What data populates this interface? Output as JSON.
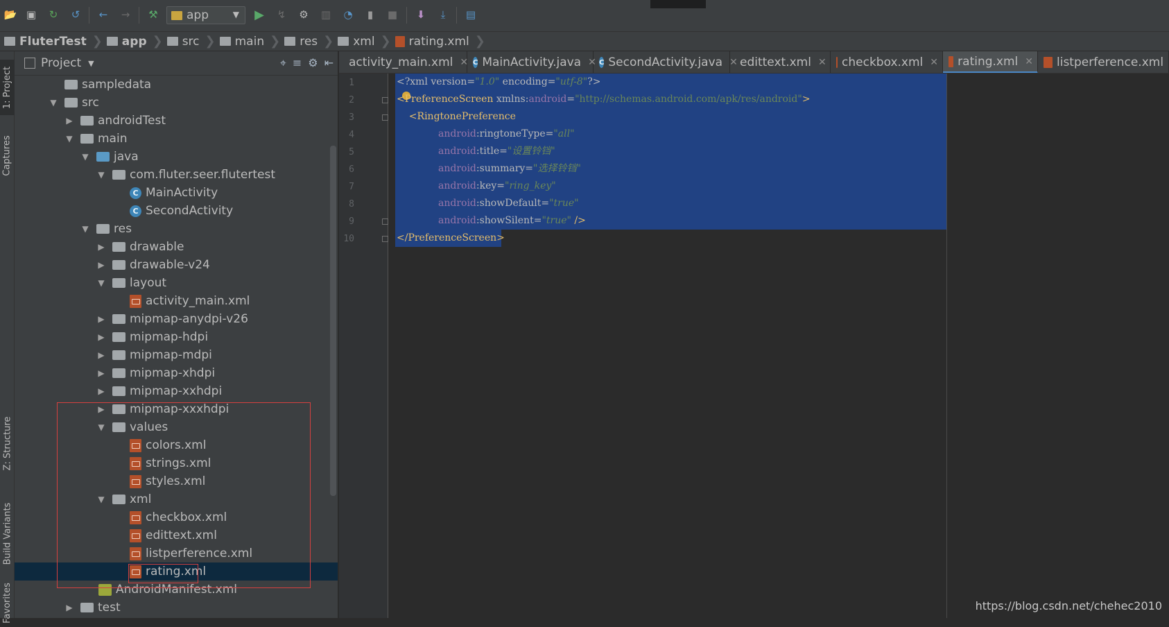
{
  "toolbar": {
    "run_config": "app",
    "icons": [
      "open-icon",
      "save-icon",
      "sync-icon",
      "refresh-icon",
      "back-icon",
      "forward-icon",
      "build-icon",
      "run-icon",
      "apply-changes-icon",
      "debug-icon",
      "attach-debugger-icon",
      "profiler-icon",
      "device-icon",
      "stop-icon",
      "sdk-manager-icon",
      "download-icon",
      "layout-inspector-icon"
    ]
  },
  "breadcrumb": [
    "FluterTest",
    "app",
    "src",
    "main",
    "res",
    "xml",
    "rating.xml"
  ],
  "left_strip": {
    "project": "1: Project",
    "captures": "Captures",
    "structure": "Z: Structure",
    "build_variants": "Build Variants",
    "favorites": "Favorites"
  },
  "project_panel": {
    "title": "Project",
    "tree": [
      {
        "label": "sampledata"
      },
      {
        "label": "src"
      },
      {
        "label": "androidTest"
      },
      {
        "label": "main"
      },
      {
        "label": "java"
      },
      {
        "label": "com.fluter.seer.flutertest"
      },
      {
        "label": "MainActivity"
      },
      {
        "label": "SecondActivity"
      },
      {
        "label": "res"
      },
      {
        "label": "drawable"
      },
      {
        "label": "drawable-v24"
      },
      {
        "label": "layout"
      },
      {
        "label": "activity_main.xml"
      },
      {
        "label": "mipmap-anydpi-v26"
      },
      {
        "label": "mipmap-hdpi"
      },
      {
        "label": "mipmap-mdpi"
      },
      {
        "label": "mipmap-xhdpi"
      },
      {
        "label": "mipmap-xxhdpi"
      },
      {
        "label": "mipmap-xxxhdpi"
      },
      {
        "label": "values"
      },
      {
        "label": "colors.xml"
      },
      {
        "label": "strings.xml"
      },
      {
        "label": "styles.xml"
      },
      {
        "label": "xml"
      },
      {
        "label": "checkbox.xml"
      },
      {
        "label": "edittext.xml"
      },
      {
        "label": "listperference.xml"
      },
      {
        "label": "rating.xml"
      },
      {
        "label": "AndroidManifest.xml"
      },
      {
        "label": "test"
      }
    ]
  },
  "tabs": [
    "activity_main.xml",
    "MainActivity.java",
    "SecondActivity.java",
    "edittext.xml",
    "checkbox.xml",
    "rating.xml",
    "listperference.xml"
  ],
  "tabs_active": "rating.xml",
  "editor": {
    "line_numbers": [
      "1",
      "2",
      "3",
      "4",
      "5",
      "6",
      "7",
      "8",
      "9",
      "10"
    ],
    "lines": [
      {
        "p1": "<?xml version=",
        "p2": "\"1.0\"",
        "p3": " encoding=",
        "p4": "\"utf-8\"",
        "p5": "?>"
      },
      {
        "p1": "<PreferenceScreen ",
        "p2": "xmlns:",
        "p3": "android",
        "p4": "=",
        "p5": "\"http://schemas.android.com/apk/res/android\"",
        "p6": ">"
      },
      {
        "p1": "    <RingtonePreference"
      },
      {
        "ns": "android",
        "att": ":ringtoneType=",
        "val": "\"all\""
      },
      {
        "ns": "android",
        "att": ":title=",
        "val": "\"设置铃铛\""
      },
      {
        "ns": "android",
        "att": ":summary=",
        "val": "\"选择铃铛\""
      },
      {
        "ns": "android",
        "att": ":key=",
        "val": "\"ring_key\""
      },
      {
        "ns": "android",
        "att": ":showDefault=",
        "val": "\"true\""
      },
      {
        "ns": "android",
        "att": ":showSilent=",
        "val": "\"true\"",
        "end": " />"
      },
      {
        "p1": "</PreferenceScreen>"
      }
    ]
  },
  "watermark": "https://blog.csdn.net/chehec2010"
}
